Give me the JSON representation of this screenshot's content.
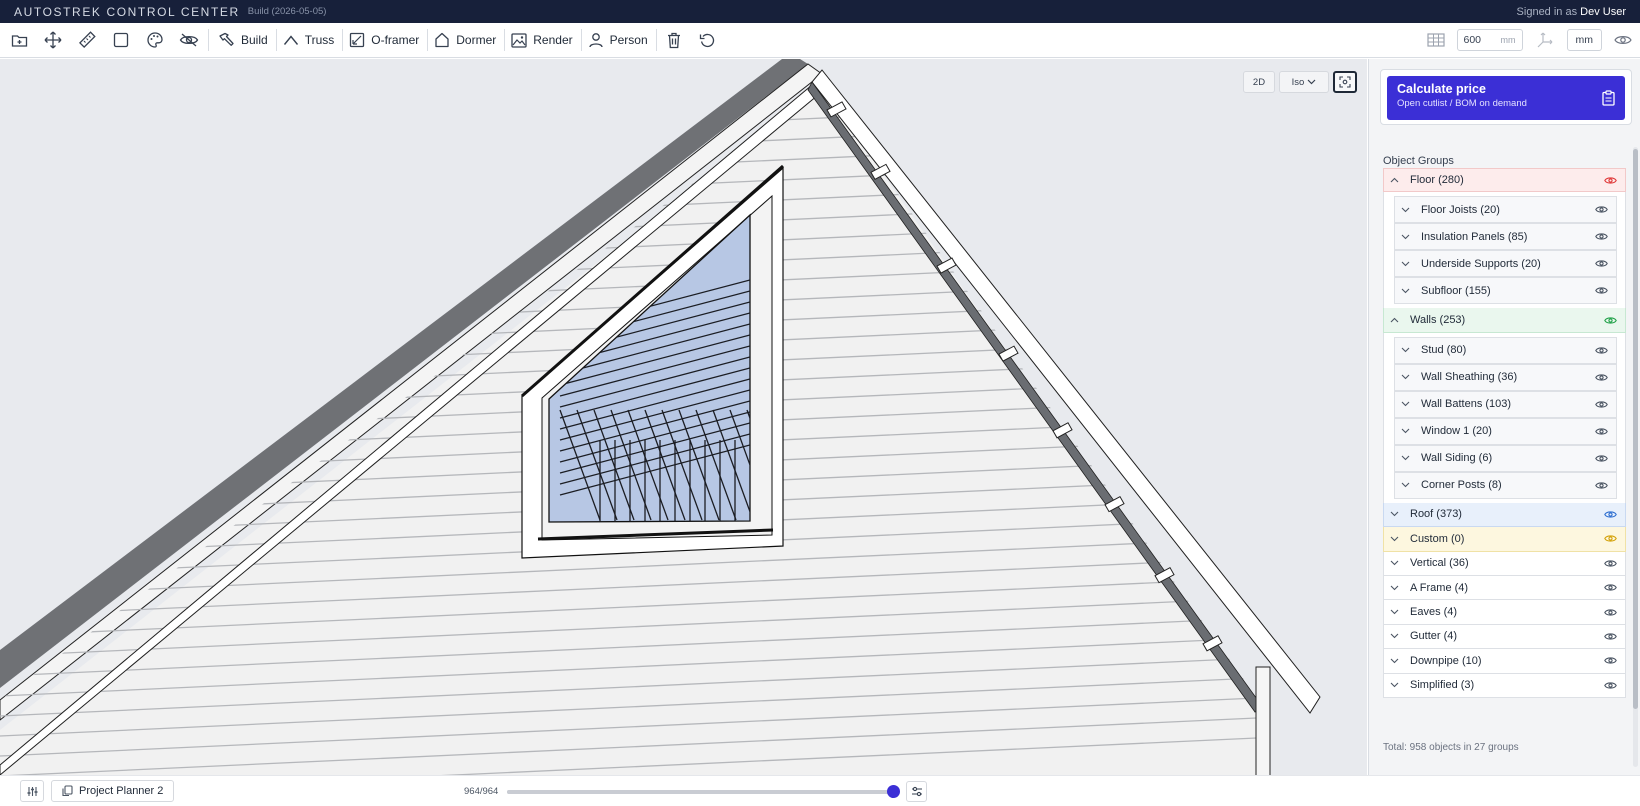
{
  "titlebar": {
    "app_name": "AUTOSTREK CONTROL CENTER",
    "build": "Build (2026-05-05)",
    "signed_in_prefix": "Signed in as",
    "user": "Dev User"
  },
  "toolbar": {
    "icons": [
      "new-folder-icon",
      "move-icon",
      "ruler-icon",
      "select-square-icon",
      "palette-icon",
      "hide-icon"
    ],
    "buttons": [
      {
        "label": "Build",
        "icon": "hammer-icon"
      },
      {
        "label": "Truss",
        "icon": "truss-icon"
      },
      {
        "label": "O-framer",
        "icon": "frame-icon"
      },
      {
        "label": "Dormer",
        "icon": "dormer-icon"
      },
      {
        "label": "Render",
        "icon": "image-icon"
      },
      {
        "label": "Person",
        "icon": "person-icon"
      }
    ],
    "right": {
      "grid_value": "600",
      "grid_unit": "mm",
      "unit_label": "mm"
    }
  },
  "viewport": {
    "view_2d": "2D",
    "view_mode": "Iso"
  },
  "sidebar": {
    "price_title": "Calculate price",
    "price_subtitle": "Open cutlist / BOM on demand",
    "groups_title": "Object Groups",
    "groups": [
      {
        "label": "Floor (280)",
        "tone": "red",
        "expanded": true,
        "eye_color": "#e03a3a",
        "children": [
          "Floor Joists (20)",
          "Insulation Panels (85)",
          "Underside Supports (20)",
          "Subfloor (155)"
        ]
      },
      {
        "label": "Walls (253)",
        "tone": "green",
        "expanded": true,
        "eye_color": "#22a24a",
        "children": [
          "Stud (80)",
          "Wall Sheathing (36)",
          "Wall Battens (103)",
          "Window 1 (20)",
          "Wall Siding (6)",
          "Corner Posts (8)"
        ]
      },
      {
        "label": "Roof (373)",
        "tone": "blue",
        "expanded": false,
        "eye_color": "#2f6fd0",
        "children": []
      },
      {
        "label": "Custom (0)",
        "tone": "yellow",
        "expanded": false,
        "eye_color": "#d4a20a",
        "children": []
      },
      {
        "label": "Vertical (36)",
        "tone": "",
        "expanded": false,
        "eye_color": "#4b5563",
        "children": []
      },
      {
        "label": "A Frame (4)",
        "tone": "",
        "expanded": false,
        "eye_color": "#4b5563",
        "children": []
      },
      {
        "label": "Eaves (4)",
        "tone": "",
        "expanded": false,
        "eye_color": "#4b5563",
        "children": []
      },
      {
        "label": "Gutter (4)",
        "tone": "",
        "expanded": false,
        "eye_color": "#4b5563",
        "children": []
      },
      {
        "label": "Downpipe (10)",
        "tone": "",
        "expanded": false,
        "eye_color": "#4b5563",
        "children": []
      },
      {
        "label": "Simplified (3)",
        "tone": "",
        "expanded": false,
        "eye_color": "#4b5563",
        "children": []
      }
    ],
    "total": "Total: 958 objects in 27 groups"
  },
  "statusbar": {
    "project": "Project Planner 2",
    "count": "964/964",
    "slider_fraction": 1.0
  },
  "colors": {
    "accent": "#3b2fd6",
    "titlebar_bg": "#17203a"
  }
}
